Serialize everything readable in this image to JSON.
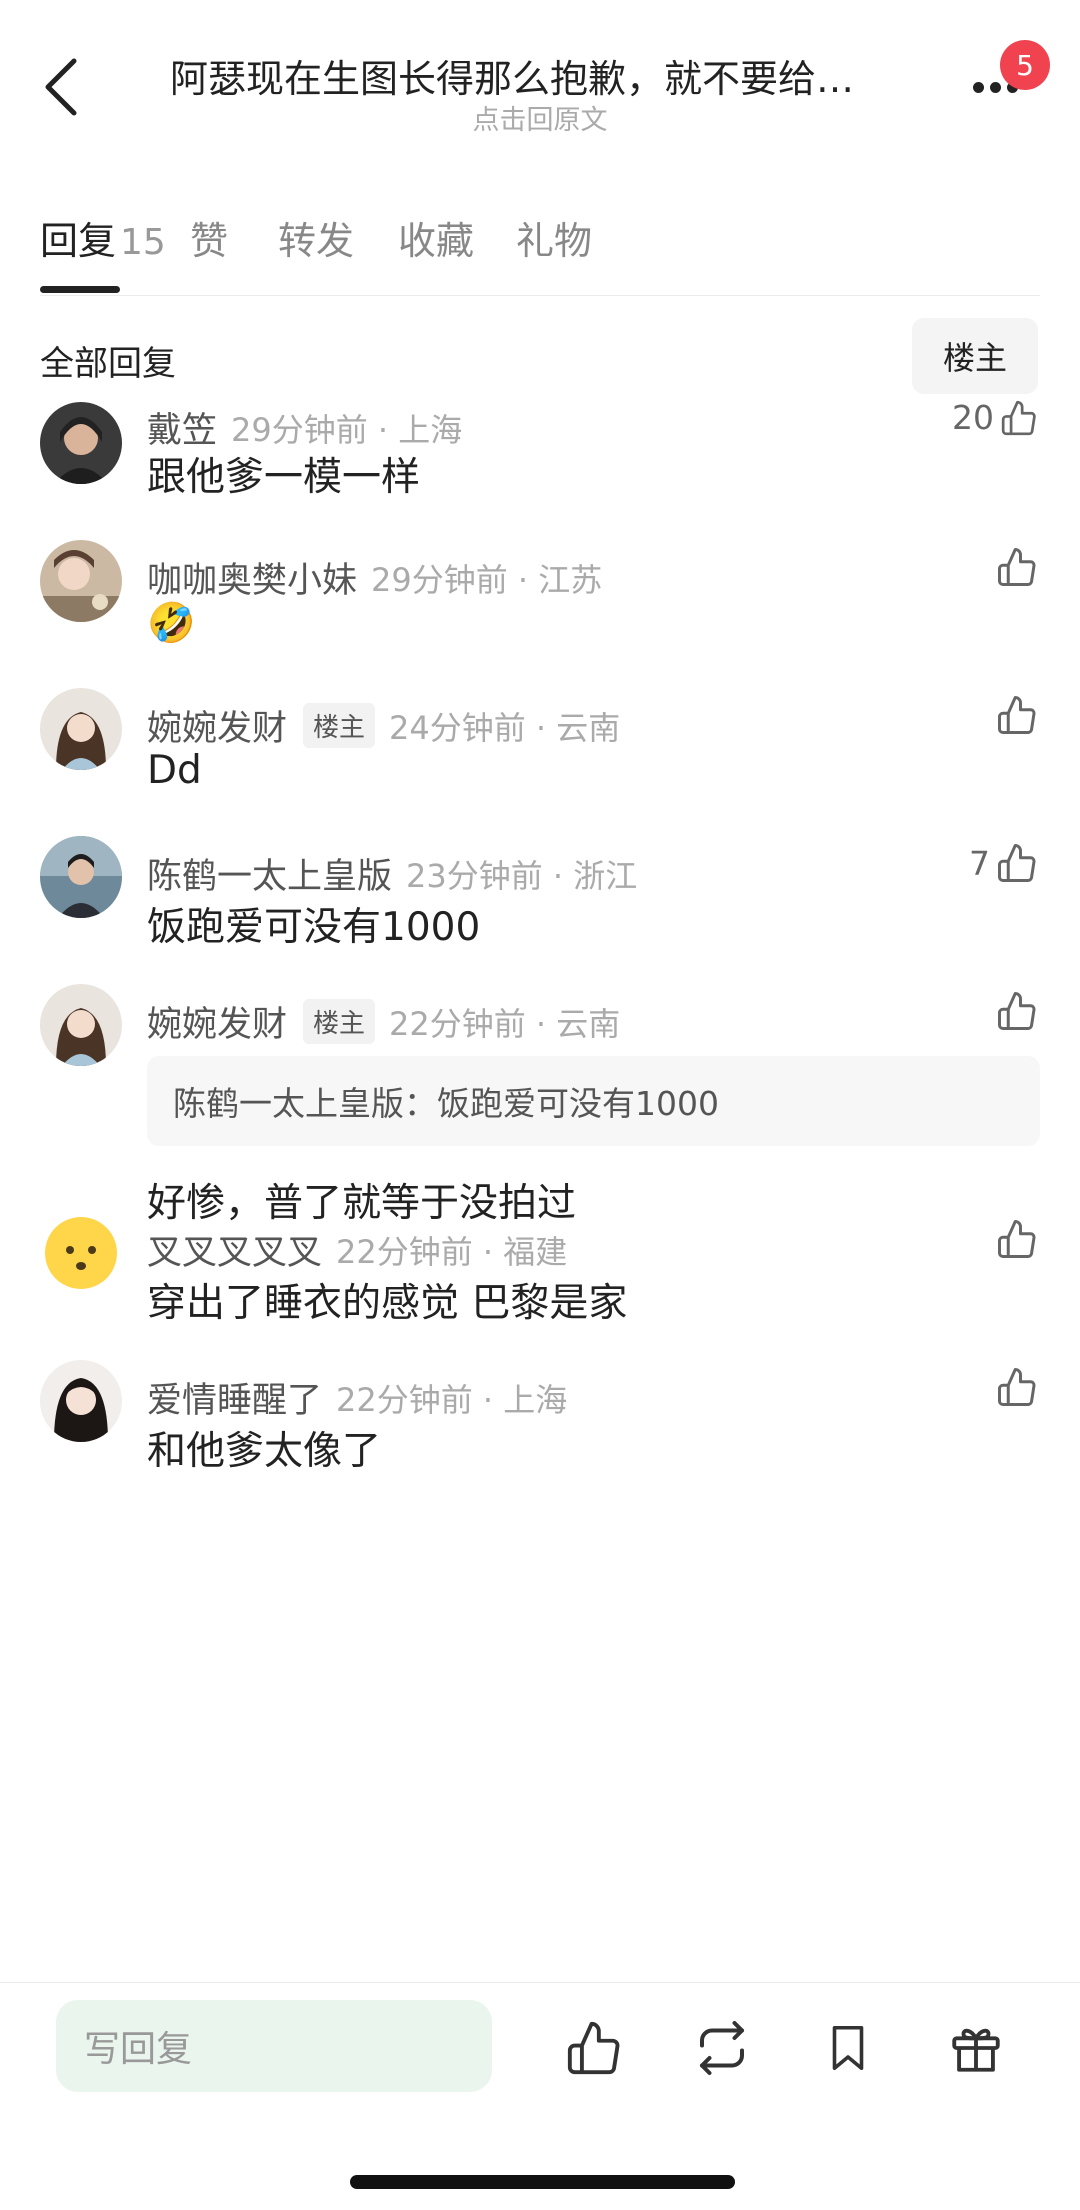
{
  "header": {
    "title": "阿瑟现在生图长得那么抱歉，就不要给…",
    "subtitle": "点击回原文",
    "badge_count": "5",
    "icons": {
      "back": "chevron-left-icon",
      "more": "more-dots-icon"
    }
  },
  "tabs": [
    {
      "label": "回复",
      "count": "15",
      "active": true
    },
    {
      "label": "赞"
    },
    {
      "label": "转发"
    },
    {
      "label": "收藏"
    },
    {
      "label": "礼物"
    }
  ],
  "filter": {
    "title": "全部回复",
    "owner_button": "楼主"
  },
  "comments": [
    {
      "username": "戴笠",
      "time": "29分钟前 · 上海",
      "content": "跟他爹一模一样",
      "likes": "20"
    },
    {
      "username": "咖咖奥樊小妹",
      "time": "29分钟前 · 江苏",
      "content": "🤣",
      "likes": ""
    },
    {
      "username": "婉婉发财",
      "tag": "楼主",
      "time": "24分钟前 · 云南",
      "content": "Dd",
      "likes": ""
    },
    {
      "username": "陈鹤一太上皇版",
      "time": "23分钟前 · 浙江",
      "content": "饭跑爱可没有1000",
      "likes": "7"
    },
    {
      "username": "婉婉发财",
      "tag": "楼主",
      "time": "22分钟前 · 云南",
      "quote": "陈鹤一太上皇版：饭跑爱可没有1000",
      "content": "好惨，普了就等于没拍过",
      "likes": ""
    },
    {
      "username": "叉叉叉叉叉",
      "time": "22分钟前 · 福建",
      "content": "穿出了睡衣的感觉 巴黎是家",
      "likes": ""
    },
    {
      "username": "爱情睡醒了",
      "time": "22分钟前 · 上海",
      "content": "和他爹太像了",
      "likes": ""
    }
  ],
  "bottom_bar": {
    "reply_placeholder": "写回复",
    "icons": [
      "thumbs-up-icon",
      "repost-icon",
      "bookmark-icon",
      "gift-icon"
    ]
  },
  "colors": {
    "badge": "#f0424f",
    "reply_input_bg": "#eaf5ee",
    "text": "#222222",
    "secondary": "#888888"
  }
}
